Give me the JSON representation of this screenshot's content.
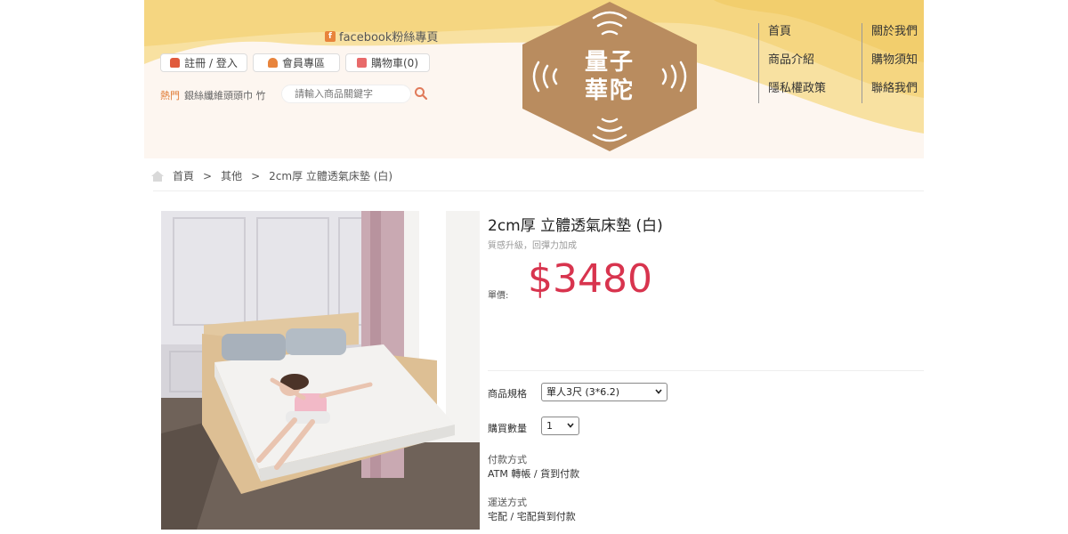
{
  "header": {
    "facebook_label": "facebook粉絲專頁",
    "register_login": "註冊 / 登入",
    "member_area": "會員專區",
    "cart": "購物車(0)",
    "hot_label": "熱門",
    "hot_terms": "銀絲纖維頭頭巾 竹",
    "search_placeholder": "請輸入商品關鍵字"
  },
  "logo": {
    "line1": "量子",
    "line2": "華陀"
  },
  "nav": {
    "col1": [
      "首頁",
      "商品介紹",
      "隱私權政策"
    ],
    "col2": [
      "關於我們",
      "購物須知",
      "聯絡我們"
    ]
  },
  "breadcrumb": {
    "home": "首頁",
    "sep": ">",
    "category": "其他",
    "current": "2cm厚 立體透氣床墊 (白)"
  },
  "product": {
    "title": "2cm厚 立體透氣床墊 (白)",
    "subtitle": "質感升級，回彈力加成",
    "price_label": "單價:",
    "price": "$3480",
    "spec_label": "商品規格",
    "spec_value": "單人3尺 (3*6.2)",
    "qty_label": "購買數量",
    "qty_value": "1",
    "payment_label": "付款方式",
    "payment_value": "ATM 轉帳 / 貨到付款",
    "shipping_label": "運送方式",
    "shipping_value": "宅配 / 宅配貨到付款"
  },
  "colors": {
    "accent_price": "#d8344e",
    "logo_bg": "#b98c5f",
    "header_wash": "#f5d27a"
  }
}
